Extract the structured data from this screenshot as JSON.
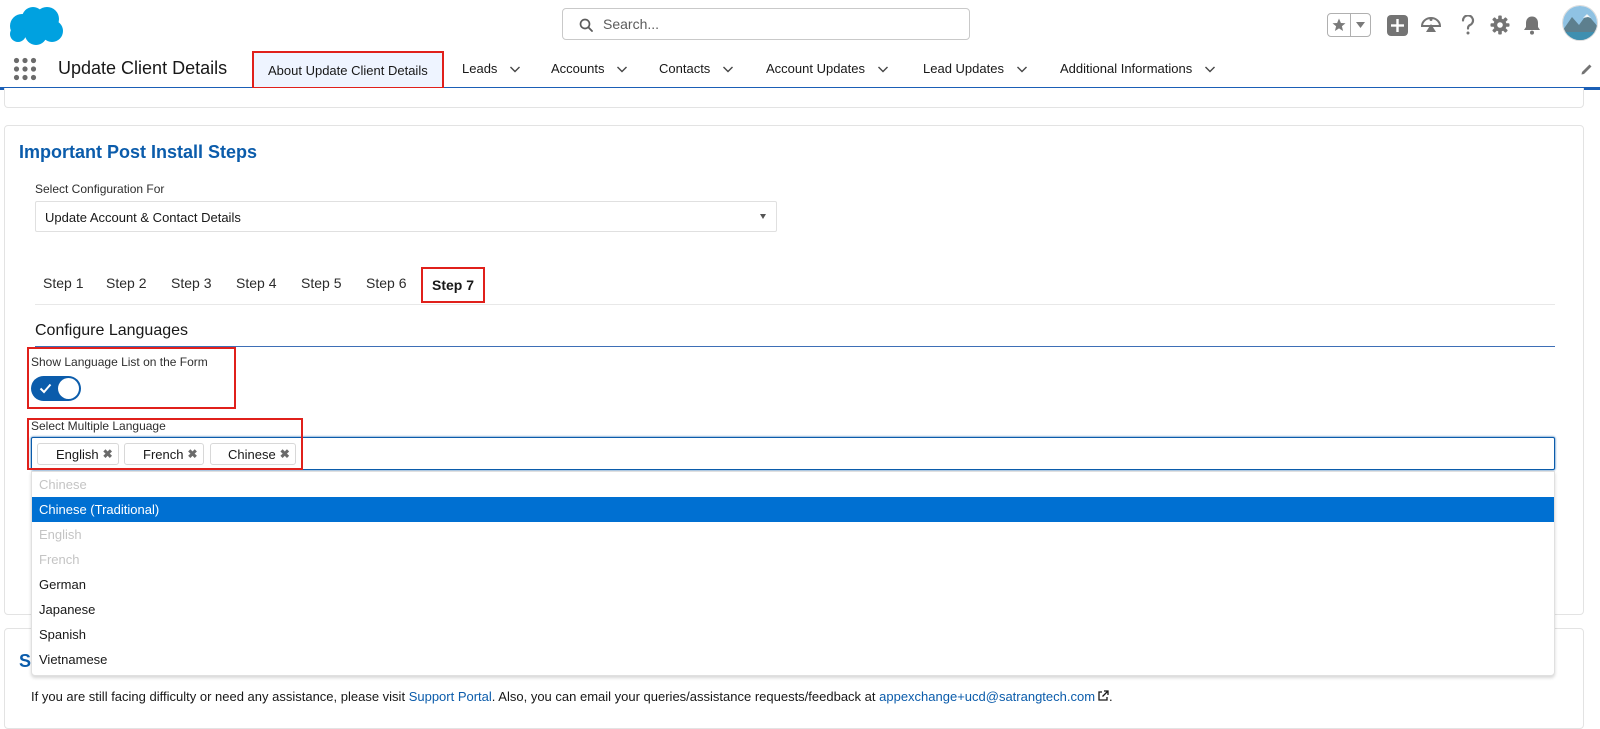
{
  "header": {
    "search_placeholder": "Search...",
    "icons": [
      "salesforce-cloud-logo",
      "search-icon",
      "favorites-star-icon",
      "favorites-dropdown-icon",
      "add-icon",
      "trailhead-icon",
      "help-icon",
      "settings-gear-icon",
      "notifications-bell-icon",
      "user-avatar"
    ]
  },
  "nav": {
    "app_name": "Update Client Details",
    "tabs": [
      {
        "label": "About Update Client Details",
        "active": true
      },
      {
        "label": "Leads"
      },
      {
        "label": "Accounts"
      },
      {
        "label": "Contacts"
      },
      {
        "label": "Account Updates"
      },
      {
        "label": "Lead Updates"
      },
      {
        "label": "Additional Informations"
      }
    ]
  },
  "main": {
    "section_title": "Important Post Install Steps",
    "config_label": "Select Configuration For",
    "config_value": "Update Account & Contact Details",
    "steps": [
      "Step 1",
      "Step 2",
      "Step 3",
      "Step 4",
      "Step 5",
      "Step 6",
      "Step 7"
    ],
    "active_step": "Step 7",
    "configure_title": "Configure Languages",
    "toggle_label": "Show Language List on the Form",
    "toggle_on": true,
    "multi_label": "Select Multiple Language",
    "selected_pills": [
      "English",
      "French",
      "Chinese"
    ],
    "options": [
      {
        "label": "Chinese",
        "state": "disabled"
      },
      {
        "label": "Chinese (Traditional)",
        "state": "highlighted"
      },
      {
        "label": "English",
        "state": "disabled"
      },
      {
        "label": "French",
        "state": "disabled"
      },
      {
        "label": "German",
        "state": "normal"
      },
      {
        "label": "Japanese",
        "state": "normal"
      },
      {
        "label": "Spanish",
        "state": "normal"
      },
      {
        "label": "Vietnamese",
        "state": "normal"
      }
    ]
  },
  "support": {
    "title_initial": "S",
    "text_before": "If you are still facing difficulty or need any assistance, please visit ",
    "portal_link": "Support Portal",
    "text_middle": ". Also, you can email your queries/assistance requests/feedback at ",
    "email_link": "appexchange+ucd@satrangtech.com",
    "text_after": "."
  },
  "colors": {
    "brand_blue": "#0b5cab",
    "selected_option": "#0070d2",
    "highlight_red": "#e0201b",
    "salesforce_cloud": "#00a1e0"
  }
}
